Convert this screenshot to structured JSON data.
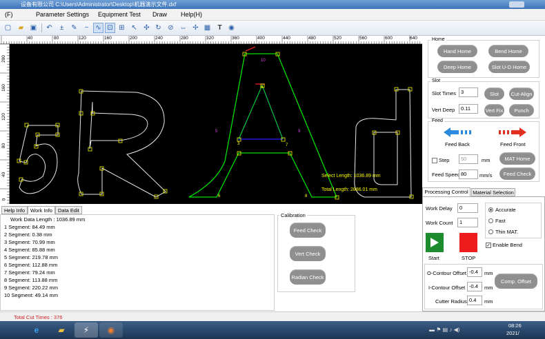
{
  "window": {
    "title": "  设备有限公司  C:\\Users\\Administrator\\Desktop\\机器演示文件.dxf"
  },
  "menu": [
    "(F)",
    "Parameter Settings",
    "Equipment Test",
    "Draw",
    "Help(H)"
  ],
  "toolbar_icons": [
    "new-file-icon",
    "open-folder-icon",
    "save-icon",
    "undo-icon",
    "add-node-icon",
    "pen-icon",
    "delete-node-icon",
    "node-mode-icon",
    "select-node-icon",
    "zoom-box-icon",
    "pointer-icon",
    "move-icon",
    "rotate-icon",
    "mirror-icon",
    "align-icon",
    "arrange-icon",
    "grid-icon",
    "text-icon",
    "info-icon"
  ],
  "ruler": {
    "top": [
      "40",
      "80",
      "120",
      "160",
      "200",
      "240",
      "280",
      "320",
      "360",
      "400",
      "440",
      "480",
      "520",
      "560",
      "600",
      "640"
    ],
    "left": [
      "200",
      "160",
      "120",
      "80",
      "40",
      "0"
    ]
  },
  "canvas": {
    "labels": [
      "10",
      "4",
      "5",
      "9",
      "3",
      "7",
      "6",
      "8"
    ],
    "select_length": "Select Length: 1036.89 mm",
    "total_length": "Total Length: 2886.01 mm"
  },
  "home": {
    "title": "Home",
    "buttons": [
      "Hand Home",
      "Bend Home",
      "Deep Home",
      "Slot U-D Home"
    ]
  },
  "slot": {
    "title": "Slot",
    "slot_times_label": "Slot Times",
    "slot_times_value": "3",
    "vert_deep_label": "Vert Deep",
    "vert_deep_value": "0.11",
    "buttons": [
      "Slot",
      "Cut-Align",
      "Vert Fix",
      "Punch"
    ]
  },
  "feed": {
    "title": "Feed",
    "feed_back": "Feed Back",
    "feed_front": "Feed Front",
    "step_label": "Step",
    "step_value": "50",
    "step_unit": "mm",
    "speed_label": "Feed Speed",
    "speed_value": "80",
    "speed_unit": "mm/s",
    "mat_home": "MAT Home",
    "feed_check": "Feed Check"
  },
  "tabs_right": [
    "Processing Control",
    "Material Selection"
  ],
  "processing": {
    "work_delay_label": "Work Delay",
    "work_delay_value": "0",
    "work_count_label": "Work Count",
    "work_count_value": "1",
    "modes": [
      "Accurate",
      "Fast",
      "Thin MAT."
    ],
    "enable_bend": "Enable Bend",
    "start": "Start",
    "stop": "STOP"
  },
  "offset": {
    "o_label": "O-Contour Offset",
    "o_value": "-0.4",
    "o_unit": "mm",
    "i_label": "I-Contour Offset",
    "i_value": "-0.4",
    "i_unit": "mm",
    "r_label": "Cutter Radius",
    "r_value": "0.4",
    "r_unit": "mm",
    "comp": "Comp. Offset"
  },
  "calibration": {
    "title": "Calibration",
    "buttons": [
      "Feed Check",
      "Vert Check",
      "Radian Check"
    ]
  },
  "tabs_left": [
    "Help Info",
    "Work Info",
    "Data Edit"
  ],
  "work_info": [
    "Work Data Length : 1036.89 mm",
    "1 Segment: 84.49 mm",
    "2 Segment: 0.38 mm",
    "3 Segment: 70.99 mm",
    "4 Segment: 85.88 mm",
    "5 Segment: 219.78 mm",
    "6 Segment: 112.88 mm",
    "7 Segment: 79.24 mm",
    "8 Segment: 113.88 mm",
    "9 Segment: 220.22 mm",
    "10 Segment: 49.14 mm"
  ],
  "status": {
    "total_cut": "Total Cut Times : 376"
  },
  "taskbar": {
    "time": "08:26",
    "date": "2021/"
  },
  "colors": {
    "accent_blue": "#2a8be0",
    "red": "#e03020",
    "green": "#1c8c2e",
    "stop_red": "#ee1c1c",
    "shape_green": "#00e000",
    "shape_white": "#e8e8e8",
    "node_yellow": "#e0e000"
  }
}
